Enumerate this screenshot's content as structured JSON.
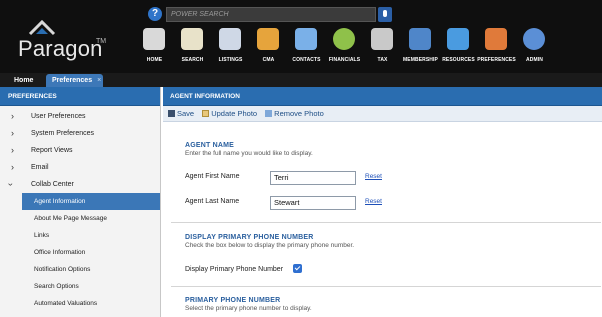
{
  "header": {
    "logo_text": "Paragon",
    "logo_tm": "TM",
    "search_help": "?",
    "search_placeholder": "POWER SEARCH",
    "nav": [
      {
        "label": "HOME",
        "icon": "home-icon",
        "color": "#d9d9d9"
      },
      {
        "label": "SEARCH",
        "icon": "search-icon",
        "color": "#e8e2c9"
      },
      {
        "label": "LISTINGS",
        "icon": "listings-icon",
        "color": "#cfd8e6"
      },
      {
        "label": "CMA",
        "icon": "cma-icon",
        "color": "#e6a43c"
      },
      {
        "label": "CONTACTS",
        "icon": "contacts-icon",
        "color": "#7ab0e8"
      },
      {
        "label": "FINANCIALS",
        "icon": "financials-icon",
        "color": "#8fc14a"
      },
      {
        "label": "TAX",
        "icon": "tax-icon",
        "color": "#c9c9c9"
      },
      {
        "label": "MEMBERSHIP",
        "icon": "membership-icon",
        "color": "#4f86c9"
      },
      {
        "label": "RESOURCES",
        "icon": "resources-icon",
        "color": "#4a9be0"
      },
      {
        "label": "PREFERENCES",
        "icon": "preferences-icon",
        "color": "#e07a3a"
      },
      {
        "label": "ADMIN",
        "icon": "admin-icon",
        "color": "#5b8fd6"
      }
    ]
  },
  "tabs": {
    "home": "Home",
    "preferences": "Preferences",
    "close": "×"
  },
  "sidebar": {
    "title": "PREFERENCES",
    "items": [
      {
        "label": "User Preferences"
      },
      {
        "label": "System Preferences"
      },
      {
        "label": "Report Views"
      },
      {
        "label": "Email"
      },
      {
        "label": "Collab Center"
      }
    ],
    "sub_items": [
      {
        "label": "Agent Information"
      },
      {
        "label": "About Me Page Message"
      },
      {
        "label": "Links"
      },
      {
        "label": "Office Information"
      },
      {
        "label": "Notification Options"
      },
      {
        "label": "Search Options"
      },
      {
        "label": "Automated Valuations"
      }
    ]
  },
  "main": {
    "title": "AGENT INFORMATION",
    "toolbar": {
      "save": "Save",
      "update_photo": "Update Photo",
      "remove_photo": "Remove Photo"
    },
    "agent_name": {
      "title": "AGENT NAME",
      "desc": "Enter the full name you would like to display.",
      "first_label": "Agent First Name",
      "first_value": "Terri",
      "last_label": "Agent Last Name",
      "last_value": "Stewart",
      "reset": "Reset"
    },
    "display_phone": {
      "title": "DISPLAY PRIMARY PHONE NUMBER",
      "desc": "Check the box below to display the primary phone number.",
      "label": "Display Primary Phone Number",
      "checked": true
    },
    "primary_phone": {
      "title": "PRIMARY PHONE NUMBER",
      "desc": "Select the primary phone number to display."
    }
  },
  "colors": {
    "header_bg": "#0f0f0f",
    "panel_title": "#2a6db0",
    "active_item": "#3b77b7",
    "section_title": "#2a5f9e",
    "link": "#1d4fb8"
  }
}
